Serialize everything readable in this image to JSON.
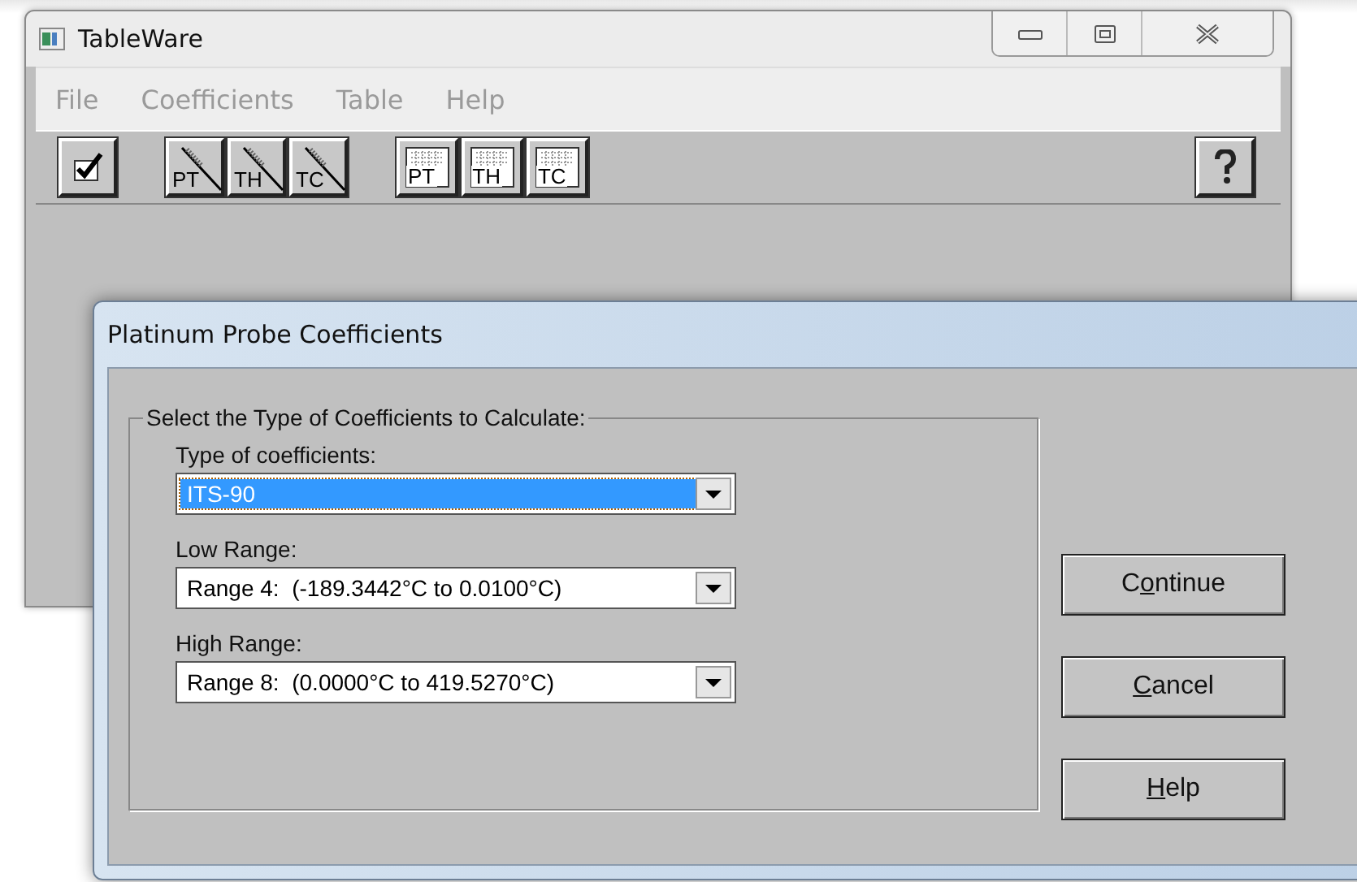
{
  "main_window": {
    "title": "TableWare",
    "menu": [
      "File",
      "Coefficients",
      "Table",
      "Help"
    ],
    "toolbar": [
      {
        "kind": "check"
      },
      {
        "kind": "probe",
        "label": "PT"
      },
      {
        "kind": "probe",
        "label": "TH"
      },
      {
        "kind": "probe",
        "label": "TC"
      },
      {
        "kind": "table",
        "label": "PT"
      },
      {
        "kind": "table",
        "label": "TH"
      },
      {
        "kind": "table",
        "label": "TC"
      },
      {
        "kind": "help"
      }
    ]
  },
  "dialog": {
    "title": "Platinum Probe Coefficients",
    "group_title": "Select the Type of Coefficients to Calculate:",
    "fields": [
      {
        "label": "Type of coefficients:",
        "value": "ITS-90",
        "focused": true
      },
      {
        "label": "Low Range:",
        "value": "Range 4:  (-189.3442°C to 0.0100°C)",
        "focused": false
      },
      {
        "label": "High Range:",
        "value": "Range 8:  (0.0000°C to 419.5270°C)",
        "focused": false
      }
    ],
    "buttons": [
      {
        "pre": "C",
        "key": "o",
        "post": "ntinue"
      },
      {
        "key": "C",
        "post": "ancel"
      },
      {
        "key": "H",
        "post": "elp"
      }
    ]
  }
}
